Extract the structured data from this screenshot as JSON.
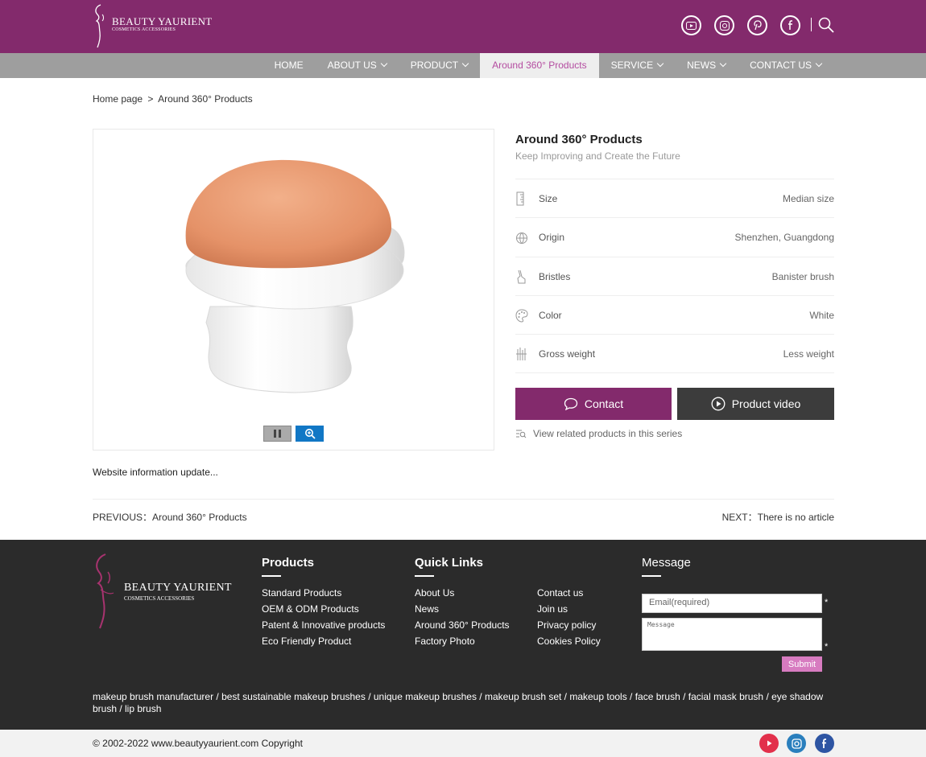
{
  "header": {
    "brand_name": "BEAUTY YAURIENT",
    "brand_tagline": "COSMETICS ACCESSORIES",
    "social": [
      "youtube-icon",
      "instagram-icon",
      "pinterest-icon",
      "facebook-icon"
    ],
    "brand_color": "#832a6c"
  },
  "nav": {
    "items": [
      {
        "label": "HOME",
        "dropdown": false
      },
      {
        "label": "ABOUT US",
        "dropdown": true
      },
      {
        "label": "PRODUCT",
        "dropdown": true
      },
      {
        "label": "Around 360° Products",
        "dropdown": false,
        "active": true
      },
      {
        "label": "SERVICE",
        "dropdown": true
      },
      {
        "label": "NEWS",
        "dropdown": true
      },
      {
        "label": "CONTACT US",
        "dropdown": true
      }
    ]
  },
  "breadcrumb": {
    "home": "Home page",
    "separator": ">",
    "current": "Around 360° Products"
  },
  "product": {
    "title": "Around 360° Products",
    "subtitle": "Keep Improving and Create the Future",
    "specs": [
      {
        "icon": "ruler-icon",
        "label": "Size",
        "value": "Median size"
      },
      {
        "icon": "globe-icon",
        "label": "Origin",
        "value": "Shenzhen, Guangdong"
      },
      {
        "icon": "brush-icon",
        "label": "Bristles",
        "value": "Banister brush"
      },
      {
        "icon": "palette-icon",
        "label": "Color",
        "value": "White"
      },
      {
        "icon": "weight-icon",
        "label": "Gross weight",
        "value": "Less weight"
      }
    ],
    "contact_label": "Contact",
    "video_label": "Product video",
    "related_label": "View related products in this series",
    "info_text": "Website information update..."
  },
  "pager": {
    "prev_label": "PREVIOUS：",
    "prev_value": "Around 360° Products",
    "next_label": "NEXT：",
    "next_value": "There is no article"
  },
  "footer": {
    "brand_name": "BEAUTY YAURIENT",
    "brand_tagline": "COSMETICS ACCESSORIES",
    "products_title": "Products",
    "products": [
      "Standard Products",
      "OEM & ODM Products",
      "Patent & Innovative products",
      "Eco Friendly Product"
    ],
    "quick_title": "Quick Links",
    "quick_col1": [
      "About Us",
      "News",
      "Around 360° Products",
      "Factory Photo"
    ],
    "quick_col2": [
      "Contact us",
      "Join us",
      "Privacy policy",
      "Cookies Policy"
    ],
    "message_title": "Message",
    "email_placeholder": "Email(required)",
    "message_placeholder": "Message",
    "required_mark": "*",
    "submit_label": "Submit",
    "tags": "makeup brush manufacturer / best sustainable makeup brushes / unique makeup brushes / makeup brush set / makeup tools / face brush / facial mask brush / eye shadow brush / lip brush",
    "copyright": "© 2002-2022 www.beautyyaurient.com Copyright"
  }
}
